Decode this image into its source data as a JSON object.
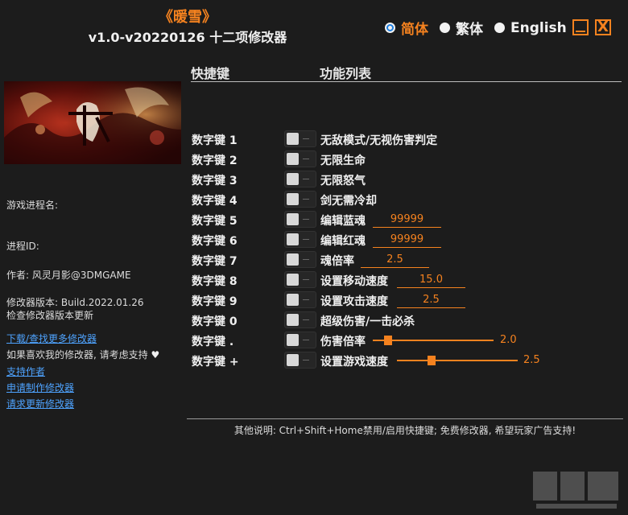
{
  "app": {
    "title_cn": "《暖雪》",
    "title_version": "v1.0-v20220126 十二项修改器"
  },
  "languages": [
    {
      "label": "简体",
      "selected": true
    },
    {
      "label": "繁体",
      "selected": false
    },
    {
      "label": "English",
      "selected": false
    }
  ],
  "window_controls": {
    "close_glyph": "X"
  },
  "table_header": {
    "hotkey": "快捷键",
    "function": "功能列表"
  },
  "sidebar": {
    "process_name_label": "游戏进程名:",
    "process_id_label": "进程ID:",
    "author": "作者: 风灵月影@3DMGAME",
    "version": "修改器版本: Build.2022.01.26",
    "check_update": "检查修改器版本更新",
    "download_more": "下载/查找更多修改器",
    "support_text": "如果喜欢我的修改器, 请考虑支持",
    "heart_glyph": "♥",
    "support_author": "支持作者",
    "request_trainer": "申请制作修改器",
    "request_update": "请求更新修改器"
  },
  "cheats": [
    {
      "hotkey": "数字键 1",
      "label": "无敌模式/无视伤害判定"
    },
    {
      "hotkey": "数字键 2",
      "label": "无限生命"
    },
    {
      "hotkey": "数字键 3",
      "label": "无限怒气"
    },
    {
      "hotkey": "数字键 4",
      "label": "剑无需冷却"
    },
    {
      "hotkey": "数字键 5",
      "label": "编辑蓝魂",
      "value": "99999"
    },
    {
      "hotkey": "数字键 6",
      "label": "编辑红魂",
      "value": "99999"
    },
    {
      "hotkey": "数字键 7",
      "label": "魂倍率",
      "value": "2.5"
    },
    {
      "hotkey": "数字键 8",
      "label": "设置移动速度",
      "value": "15.0"
    },
    {
      "hotkey": "数字键 9",
      "label": "设置攻击速度",
      "value": "2.5"
    },
    {
      "hotkey": "数字键 0",
      "label": "超级伤害/一击必杀"
    },
    {
      "hotkey": "数字键 .",
      "label": "伤害倍率",
      "slider_value": "2.0",
      "slider_fraction": 0.1
    },
    {
      "hotkey": "数字键 +",
      "label": "设置游戏速度",
      "slider_value": "2.5",
      "slider_fraction": 0.27
    }
  ],
  "footer": "其他说明: Ctrl+Shift+Home禁用/启用快捷键; 免费修改器, 希望玩家广告支持!",
  "colors": {
    "accent": "#f5821f",
    "link": "#4ea3ff",
    "background": "#1c1c1c",
    "radio_selected": "#1e7fe0"
  }
}
